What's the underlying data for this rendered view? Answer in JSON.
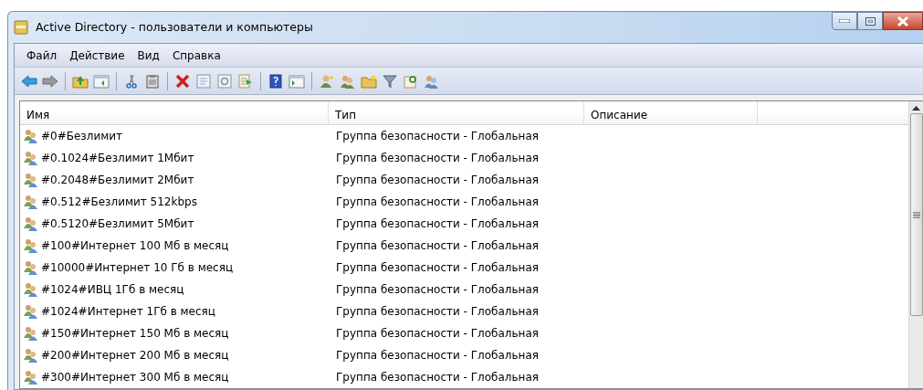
{
  "window": {
    "title": "Active Directory - пользователи и компьютеры"
  },
  "menu": [
    "Файл",
    "Действие",
    "Вид",
    "Справка"
  ],
  "table": {
    "columns": [
      "Имя",
      "Тип",
      "Описание"
    ],
    "rows": [
      {
        "name": "#0#Безлимит",
        "type": "Группа безопасности - Глобальная"
      },
      {
        "name": "#0.1024#Безлимит 1Мбит",
        "type": "Группа безопасности - Глобальная"
      },
      {
        "name": "#0.2048#Безлимит 2Мбит",
        "type": "Группа безопасности - Глобальная"
      },
      {
        "name": "#0.512#Безлимит 512kbps",
        "type": "Группа безопасности - Глобальная"
      },
      {
        "name": "#0.5120#Безлимит 5Мбит",
        "type": "Группа безопасности - Глобальная"
      },
      {
        "name": "#100#Интернет 100 Мб в месяц",
        "type": "Группа безопасности - Глобальная"
      },
      {
        "name": "#10000#Интернет 10 Гб в месяц",
        "type": "Группа безопасности - Глобальная"
      },
      {
        "name": "#1024#ИВЦ 1Гб в месяц",
        "type": "Группа безопасности - Глобальная"
      },
      {
        "name": "#1024#Интернет 1Гб в месяц",
        "type": "Группа безопасности - Глобальная"
      },
      {
        "name": "#150#Интернет 150 Мб в месяц",
        "type": "Группа безопасности - Глобальная"
      },
      {
        "name": "#200#Интернет 200 Мб в месяц",
        "type": "Группа безопасности - Глобальная"
      },
      {
        "name": "#300#Интернет 300 Мб в месяц",
        "type": "Группа безопасности - Глобальная"
      }
    ]
  }
}
